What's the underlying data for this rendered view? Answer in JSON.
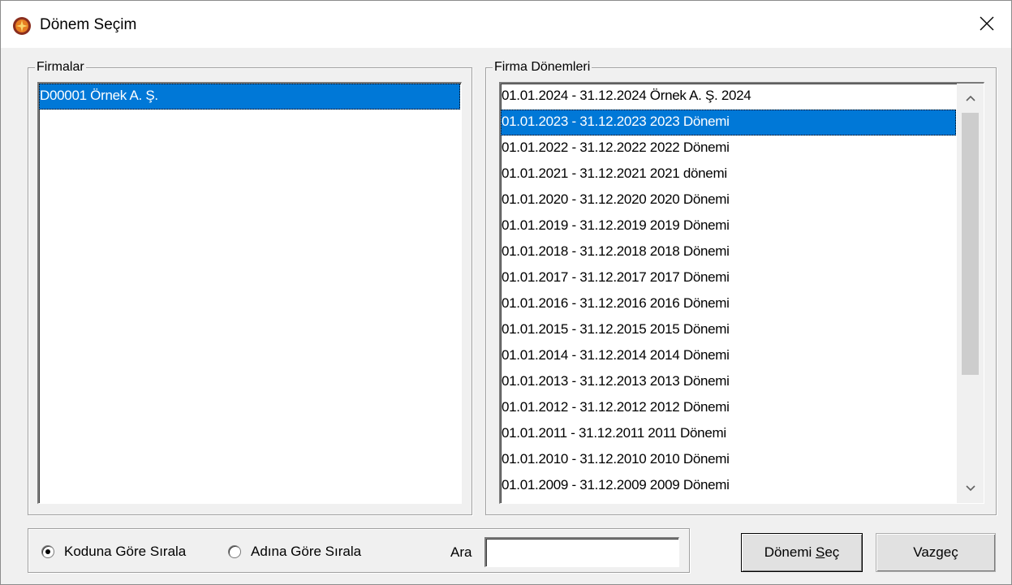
{
  "window": {
    "title": "Dönem Seçim",
    "close_glyph": "✕"
  },
  "firmalar": {
    "label": "Firmalar",
    "items": [
      {
        "text": "D00001 Örnek A. Ş.",
        "selected": true
      }
    ]
  },
  "donemler": {
    "label": "Firma Dönemleri",
    "items": [
      {
        "text": "01.01.2024 - 31.12.2024  Örnek A. Ş. 2024"
      },
      {
        "text": "01.01.2023 - 31.12.2023  2023 Dönemi",
        "selected": true
      },
      {
        "text": "01.01.2022 - 31.12.2022  2022 Dönemi"
      },
      {
        "text": "01.01.2021 - 31.12.2021  2021 dönemi"
      },
      {
        "text": "01.01.2020 - 31.12.2020  2020 Dönemi"
      },
      {
        "text": "01.01.2019 - 31.12.2019  2019 Dönemi"
      },
      {
        "text": "01.01.2018 - 31.12.2018  2018 Dönemi"
      },
      {
        "text": "01.01.2017 - 31.12.2017  2017 Dönemi"
      },
      {
        "text": "01.01.2016 - 31.12.2016  2016 Dönemi"
      },
      {
        "text": "01.01.2015 - 31.12.2015  2015 Dönemi"
      },
      {
        "text": "01.01.2014 - 31.12.2014  2014 Dönemi"
      },
      {
        "text": "01.01.2013 - 31.12.2013  2013 Dönemi"
      },
      {
        "text": "01.01.2012 - 31.12.2012  2012 Dönemi"
      },
      {
        "text": "01.01.2011 - 31.12.2011  2011 Dönemi"
      },
      {
        "text": "01.01.2010 - 31.12.2010  2010 Dönemi"
      },
      {
        "text": "01.01.2009 - 31.12.2009  2009 Dönemi"
      }
    ],
    "scroll_position": 0.0,
    "visible_fraction": 0.72
  },
  "sort": {
    "by_code_label": "Koduna Göre Sırala",
    "by_name_label": "Adına Göre Sırala",
    "selected": "code"
  },
  "search": {
    "label": "Ara",
    "value": ""
  },
  "buttons": {
    "select_label_prefix": "Dönemi ",
    "select_label_accel": "S",
    "select_label_suffix": "eç",
    "cancel_label": "Vazgeç"
  },
  "colors": {
    "selection": "#0078d7",
    "app_icon": "#c0392b"
  },
  "icons": {
    "app": "app-logo-icon",
    "close": "close-icon",
    "scroll_up": "chevron-up-icon",
    "scroll_down": "chevron-down-icon"
  }
}
